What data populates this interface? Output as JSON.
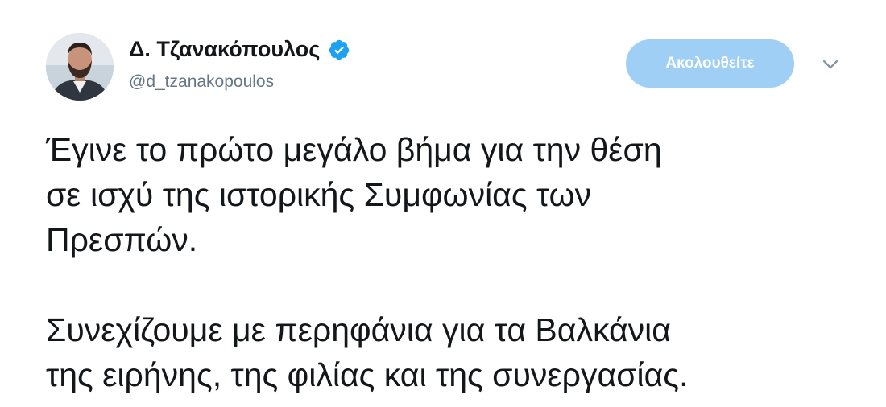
{
  "tweet": {
    "author": {
      "display_name": "Δ. Τζανακόπουλος",
      "handle": "@d_tzanakopoulos",
      "verified_icon": "verified-badge-icon",
      "avatar": "avatar-photo"
    },
    "follow_label": "Ακολουθείτε",
    "menu_icon": "chevron-down-icon",
    "colors": {
      "follow_button_bg": "#a0cff5",
      "verified": "#1da1f2",
      "handle": "#657786",
      "text": "#14171a"
    },
    "paragraphs": [
      [
        "Έγινε το πρώτο μεγάλο βήμα για την θέση",
        "σε ισχύ της ιστορικής Συμφωνίας των",
        "Πρεσπών."
      ],
      [
        "Συνεχίζουμε με περηφάνια για τα Βαλκάνια",
        "της ειρήνης, της φιλίας και της συνεργασίας."
      ]
    ]
  }
}
